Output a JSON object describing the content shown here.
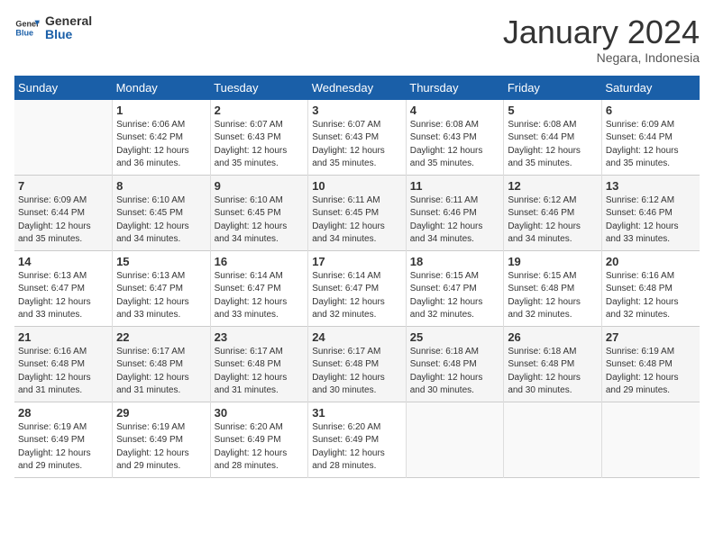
{
  "header": {
    "logo_general": "General",
    "logo_blue": "Blue",
    "month": "January 2024",
    "location": "Negara, Indonesia"
  },
  "days_of_week": [
    "Sunday",
    "Monday",
    "Tuesday",
    "Wednesday",
    "Thursday",
    "Friday",
    "Saturday"
  ],
  "weeks": [
    [
      {
        "day": "",
        "info": ""
      },
      {
        "day": "1",
        "info": "Sunrise: 6:06 AM\nSunset: 6:42 PM\nDaylight: 12 hours\nand 36 minutes."
      },
      {
        "day": "2",
        "info": "Sunrise: 6:07 AM\nSunset: 6:43 PM\nDaylight: 12 hours\nand 35 minutes."
      },
      {
        "day": "3",
        "info": "Sunrise: 6:07 AM\nSunset: 6:43 PM\nDaylight: 12 hours\nand 35 minutes."
      },
      {
        "day": "4",
        "info": "Sunrise: 6:08 AM\nSunset: 6:43 PM\nDaylight: 12 hours\nand 35 minutes."
      },
      {
        "day": "5",
        "info": "Sunrise: 6:08 AM\nSunset: 6:44 PM\nDaylight: 12 hours\nand 35 minutes."
      },
      {
        "day": "6",
        "info": "Sunrise: 6:09 AM\nSunset: 6:44 PM\nDaylight: 12 hours\nand 35 minutes."
      }
    ],
    [
      {
        "day": "7",
        "info": "Sunrise: 6:09 AM\nSunset: 6:44 PM\nDaylight: 12 hours\nand 35 minutes."
      },
      {
        "day": "8",
        "info": "Sunrise: 6:10 AM\nSunset: 6:45 PM\nDaylight: 12 hours\nand 34 minutes."
      },
      {
        "day": "9",
        "info": "Sunrise: 6:10 AM\nSunset: 6:45 PM\nDaylight: 12 hours\nand 34 minutes."
      },
      {
        "day": "10",
        "info": "Sunrise: 6:11 AM\nSunset: 6:45 PM\nDaylight: 12 hours\nand 34 minutes."
      },
      {
        "day": "11",
        "info": "Sunrise: 6:11 AM\nSunset: 6:46 PM\nDaylight: 12 hours\nand 34 minutes."
      },
      {
        "day": "12",
        "info": "Sunrise: 6:12 AM\nSunset: 6:46 PM\nDaylight: 12 hours\nand 34 minutes."
      },
      {
        "day": "13",
        "info": "Sunrise: 6:12 AM\nSunset: 6:46 PM\nDaylight: 12 hours\nand 33 minutes."
      }
    ],
    [
      {
        "day": "14",
        "info": "Sunrise: 6:13 AM\nSunset: 6:47 PM\nDaylight: 12 hours\nand 33 minutes."
      },
      {
        "day": "15",
        "info": "Sunrise: 6:13 AM\nSunset: 6:47 PM\nDaylight: 12 hours\nand 33 minutes."
      },
      {
        "day": "16",
        "info": "Sunrise: 6:14 AM\nSunset: 6:47 PM\nDaylight: 12 hours\nand 33 minutes."
      },
      {
        "day": "17",
        "info": "Sunrise: 6:14 AM\nSunset: 6:47 PM\nDaylight: 12 hours\nand 32 minutes."
      },
      {
        "day": "18",
        "info": "Sunrise: 6:15 AM\nSunset: 6:47 PM\nDaylight: 12 hours\nand 32 minutes."
      },
      {
        "day": "19",
        "info": "Sunrise: 6:15 AM\nSunset: 6:48 PM\nDaylight: 12 hours\nand 32 minutes."
      },
      {
        "day": "20",
        "info": "Sunrise: 6:16 AM\nSunset: 6:48 PM\nDaylight: 12 hours\nand 32 minutes."
      }
    ],
    [
      {
        "day": "21",
        "info": "Sunrise: 6:16 AM\nSunset: 6:48 PM\nDaylight: 12 hours\nand 31 minutes."
      },
      {
        "day": "22",
        "info": "Sunrise: 6:17 AM\nSunset: 6:48 PM\nDaylight: 12 hours\nand 31 minutes."
      },
      {
        "day": "23",
        "info": "Sunrise: 6:17 AM\nSunset: 6:48 PM\nDaylight: 12 hours\nand 31 minutes."
      },
      {
        "day": "24",
        "info": "Sunrise: 6:17 AM\nSunset: 6:48 PM\nDaylight: 12 hours\nand 30 minutes."
      },
      {
        "day": "25",
        "info": "Sunrise: 6:18 AM\nSunset: 6:48 PM\nDaylight: 12 hours\nand 30 minutes."
      },
      {
        "day": "26",
        "info": "Sunrise: 6:18 AM\nSunset: 6:48 PM\nDaylight: 12 hours\nand 30 minutes."
      },
      {
        "day": "27",
        "info": "Sunrise: 6:19 AM\nSunset: 6:48 PM\nDaylight: 12 hours\nand 29 minutes."
      }
    ],
    [
      {
        "day": "28",
        "info": "Sunrise: 6:19 AM\nSunset: 6:49 PM\nDaylight: 12 hours\nand 29 minutes."
      },
      {
        "day": "29",
        "info": "Sunrise: 6:19 AM\nSunset: 6:49 PM\nDaylight: 12 hours\nand 29 minutes."
      },
      {
        "day": "30",
        "info": "Sunrise: 6:20 AM\nSunset: 6:49 PM\nDaylight: 12 hours\nand 28 minutes."
      },
      {
        "day": "31",
        "info": "Sunrise: 6:20 AM\nSunset: 6:49 PM\nDaylight: 12 hours\nand 28 minutes."
      },
      {
        "day": "",
        "info": ""
      },
      {
        "day": "",
        "info": ""
      },
      {
        "day": "",
        "info": ""
      }
    ]
  ]
}
